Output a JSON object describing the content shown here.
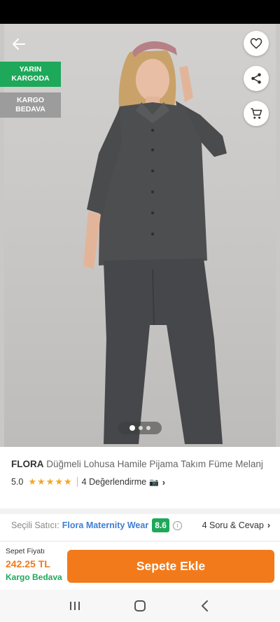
{
  "product": {
    "brand": "FLORA",
    "name": "Düğmeli Lohusa Hamile Pijama Takım Füme Melanj",
    "rating": "5.0",
    "stars": "★★★★★",
    "reviews": "4 Değerlendirme",
    "image_count": 3,
    "active_image": 1
  },
  "badges": {
    "green": [
      "YARIN",
      "KARGODA"
    ],
    "gray": [
      "KARGO",
      "BEDAVA"
    ]
  },
  "seller": {
    "label": "Seçili Satıcı:",
    "name": "Flora Maternity Wear",
    "score": "8.6",
    "qa": "4 Soru & Cevap"
  },
  "cart": {
    "price_label": "Sepet Fiyatı",
    "price": "242.25 TL",
    "cargo": "Kargo Bedava",
    "add_label": "Sepete Ekle"
  },
  "icons": {
    "back": "arrow-left-icon",
    "favorite": "heart-icon",
    "share": "share-icon",
    "cart": "cart-icon",
    "camera": "camera-icon"
  },
  "colors": {
    "accent": "#f27a1a",
    "green": "#1ea85a",
    "seller_link": "#3f7ed3",
    "star": "#f5a623"
  }
}
